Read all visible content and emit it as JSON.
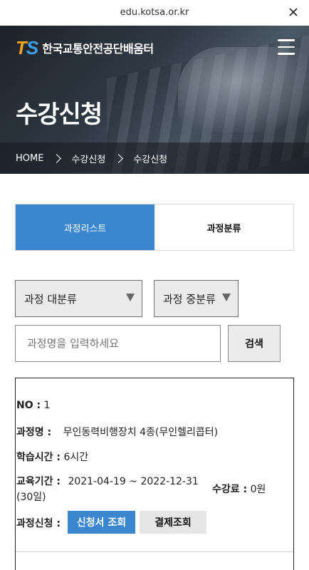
{
  "browser": {
    "url": "edu.kotsa.or.kr",
    "close_icon": "close-icon"
  },
  "header": {
    "logo_mark_t": "T",
    "logo_mark_s": "S",
    "org_name": "한국교통안전공단배움터",
    "menu_icon": "hamburger-menu-icon",
    "colors": {
      "logo_t": "#f2a31b",
      "logo_s": "#3da0e0"
    }
  },
  "hero": {
    "title": "수강신청",
    "breadcrumb": [
      "HOME",
      "수강신청",
      "수강신청"
    ]
  },
  "tabs": [
    {
      "label": "과정리스트",
      "active": true
    },
    {
      "label": "과정분류",
      "active": false
    }
  ],
  "filters": {
    "category_major": "과정 대분류",
    "category_middle": "과정 중분류"
  },
  "search": {
    "placeholder": "과정명을 입력하세요",
    "button_label": "검색"
  },
  "course": {
    "no_label": "NO :",
    "no_value": "1",
    "name_label": "과정명 :",
    "name_value": "무인동력비행장치 4종(무인헬리콥터)",
    "hours_label": "학습시간 :",
    "hours_value": "6시간",
    "period_label": "교육기간 :",
    "period_value": "2021-04-19 ~ 2022-12-31",
    "period_days": "(30일)",
    "fee_label": "수강료 :",
    "fee_value": "0원",
    "apply_label": "과정신청 :",
    "apply_button": "신청서 조회",
    "pay_button": "결제조회"
  },
  "accent_color": "#3b86cf"
}
